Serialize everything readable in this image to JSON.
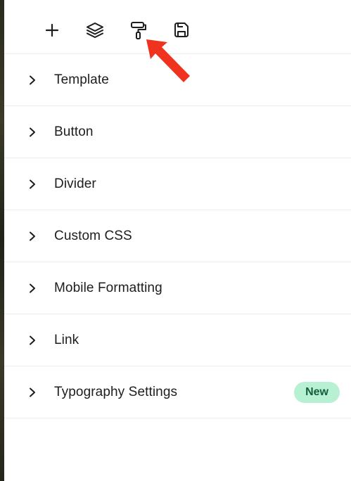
{
  "toolbar": {
    "tools": [
      {
        "icon": "plus-icon"
      },
      {
        "icon": "layers-icon"
      },
      {
        "icon": "paint-roller-icon"
      },
      {
        "icon": "save-icon"
      }
    ]
  },
  "annotation": {
    "arrow_color": "#f0331f",
    "icon": "red-pointer-arrow"
  },
  "sections": [
    {
      "label": "Template"
    },
    {
      "label": "Button"
    },
    {
      "label": "Divider"
    },
    {
      "label": "Custom CSS"
    },
    {
      "label": "Mobile Formatting"
    },
    {
      "label": "Link"
    },
    {
      "label": "Typography Settings",
      "badge": "New"
    }
  ],
  "colors": {
    "badge_bg": "#b7f0d2",
    "badge_text": "#14603a",
    "text": "#1d1d1f",
    "divider": "#ececec"
  }
}
